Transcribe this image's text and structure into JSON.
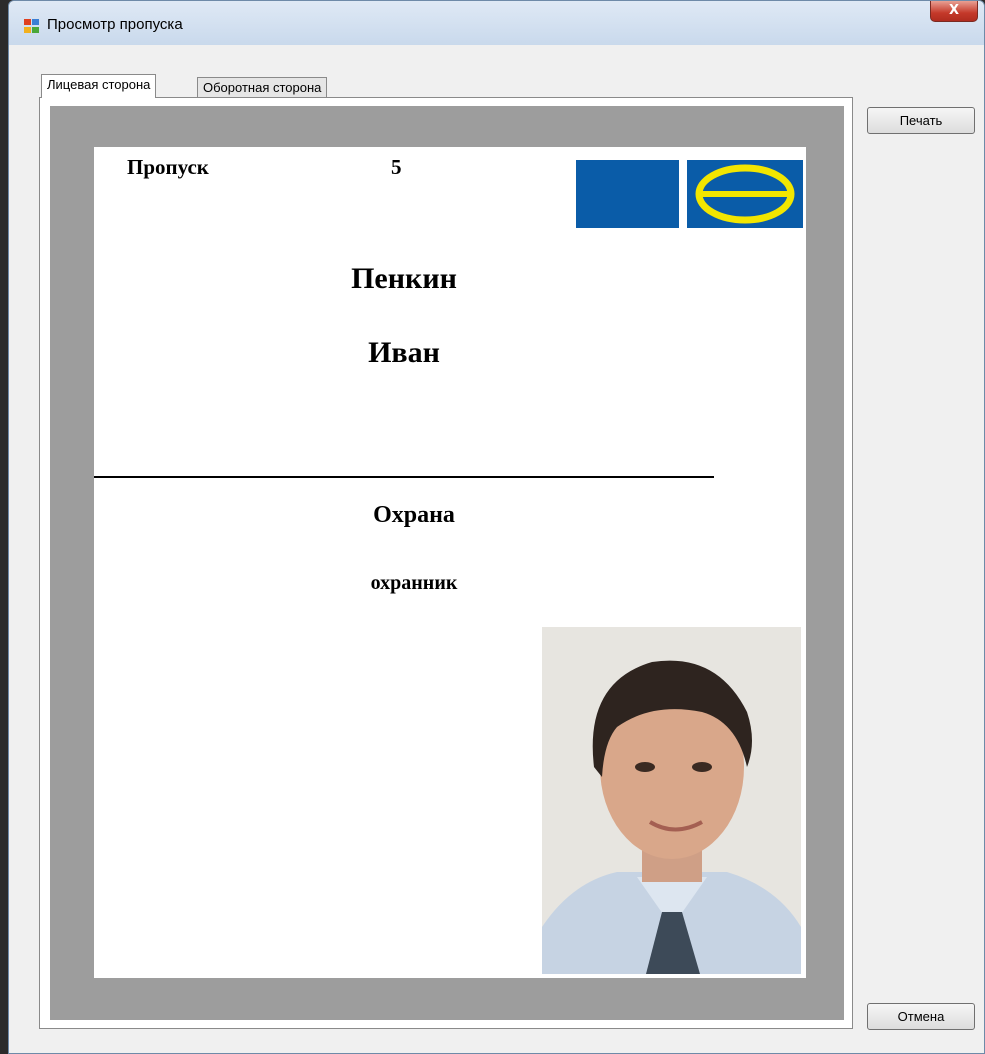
{
  "window": {
    "title": "Просмотр пропуска",
    "close_label": "X"
  },
  "tabs": [
    {
      "label": "Лицевая сторона",
      "active": true
    },
    {
      "label": "Оборотная сторона",
      "active": false
    }
  ],
  "card": {
    "pass_label": "Пропуск",
    "pass_number": "5",
    "last_name": "Пенкин",
    "first_name": "Иван",
    "department": "Охрана",
    "position": "охранник",
    "photo_alt": "Фото сотрудника"
  },
  "buttons": {
    "print": "Печать",
    "cancel": "Отмена"
  },
  "colors": {
    "logo_blue": "#0a5ca8",
    "logo_yellow": "#f2e600",
    "preview_gray": "#9d9d9d"
  }
}
